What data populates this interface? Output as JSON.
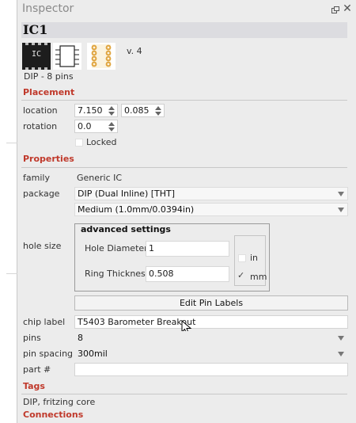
{
  "panel": {
    "title": "Inspector",
    "close_glyph": "✕"
  },
  "part": {
    "title": "IC1",
    "version": "v. 4",
    "package_summary": "DIP - 8 pins",
    "bb_icon_label": "IC"
  },
  "placement": {
    "heading": "Placement",
    "location_label": "location",
    "location_x": "7.150",
    "location_y": "0.085",
    "rotation_label": "rotation",
    "rotation_value": "0.0",
    "locked_label": "Locked",
    "locked": false
  },
  "properties": {
    "heading": "Properties",
    "family_label": "family",
    "family_value": "Generic IC",
    "package_label": "package",
    "package_value": "DIP (Dual Inline) [THT]",
    "hole_size_label": "hole size",
    "hole_size_value": "Medium (1.0mm/0.0394in)",
    "advanced": {
      "title": "advanced settings",
      "hole_diameter_label": "Hole Diameter",
      "hole_diameter_value": "1",
      "ring_thickness_label": "Ring Thickness",
      "ring_thickness_value": "0.508",
      "unit_in_label": "in",
      "unit_mm_label": "mm",
      "selected_unit": "mm"
    },
    "edit_pin_labels": "Edit Pin Labels",
    "chip_label_label": "chip label",
    "chip_label_value": "T5403 Barometer Breakout",
    "pins_label": "pins",
    "pins_value": "8",
    "pin_spacing_label": "pin spacing",
    "pin_spacing_value": "300mil",
    "part_number_label": "part #",
    "part_number_value": ""
  },
  "tags": {
    "heading": "Tags",
    "value": "DIP, fritzing core"
  },
  "connections": {
    "heading": "Connections"
  },
  "colors": {
    "section_heading": "#c0392b",
    "panel_bg": "#ececec",
    "title_bar_bg": "#dcdce0"
  },
  "icons": [
    "float-icon",
    "close-icon",
    "spin-arrows-icon",
    "dropdown-caret-icon",
    "checkmark-icon",
    "mouse-cursor-icon"
  ]
}
